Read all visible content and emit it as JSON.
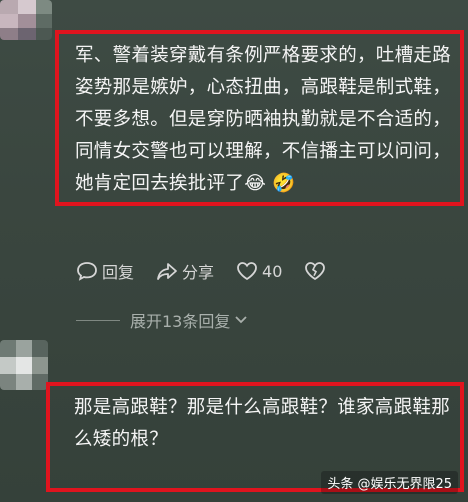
{
  "comments": [
    {
      "text": "军、警着装穿戴有条例严格要求的，吐槽走路姿势那是嫉妒，心态扭曲，高跟鞋是制式鞋，不要多想。但是穿防晒袖执勤就是不合适的，同情女交警也可以理解，不信播主可以问问，她肯定回去挨批评了😂 🤣",
      "actions": {
        "reply_label": "回复",
        "share_label": "分享",
        "like_count": "40"
      },
      "expand_replies_label": "展开13条回复"
    },
    {
      "text": "那是高跟鞋？那是什么高跟鞋？谁家高跟鞋那么矮的根？"
    }
  ],
  "watermark": "头条 @娱乐无界限25",
  "colors": {
    "highlight_border": "#e0141e",
    "background": "#3a463f"
  },
  "icons": [
    "reply-icon",
    "share-icon",
    "heart-icon",
    "broken-heart-icon",
    "chevron-down-icon"
  ]
}
